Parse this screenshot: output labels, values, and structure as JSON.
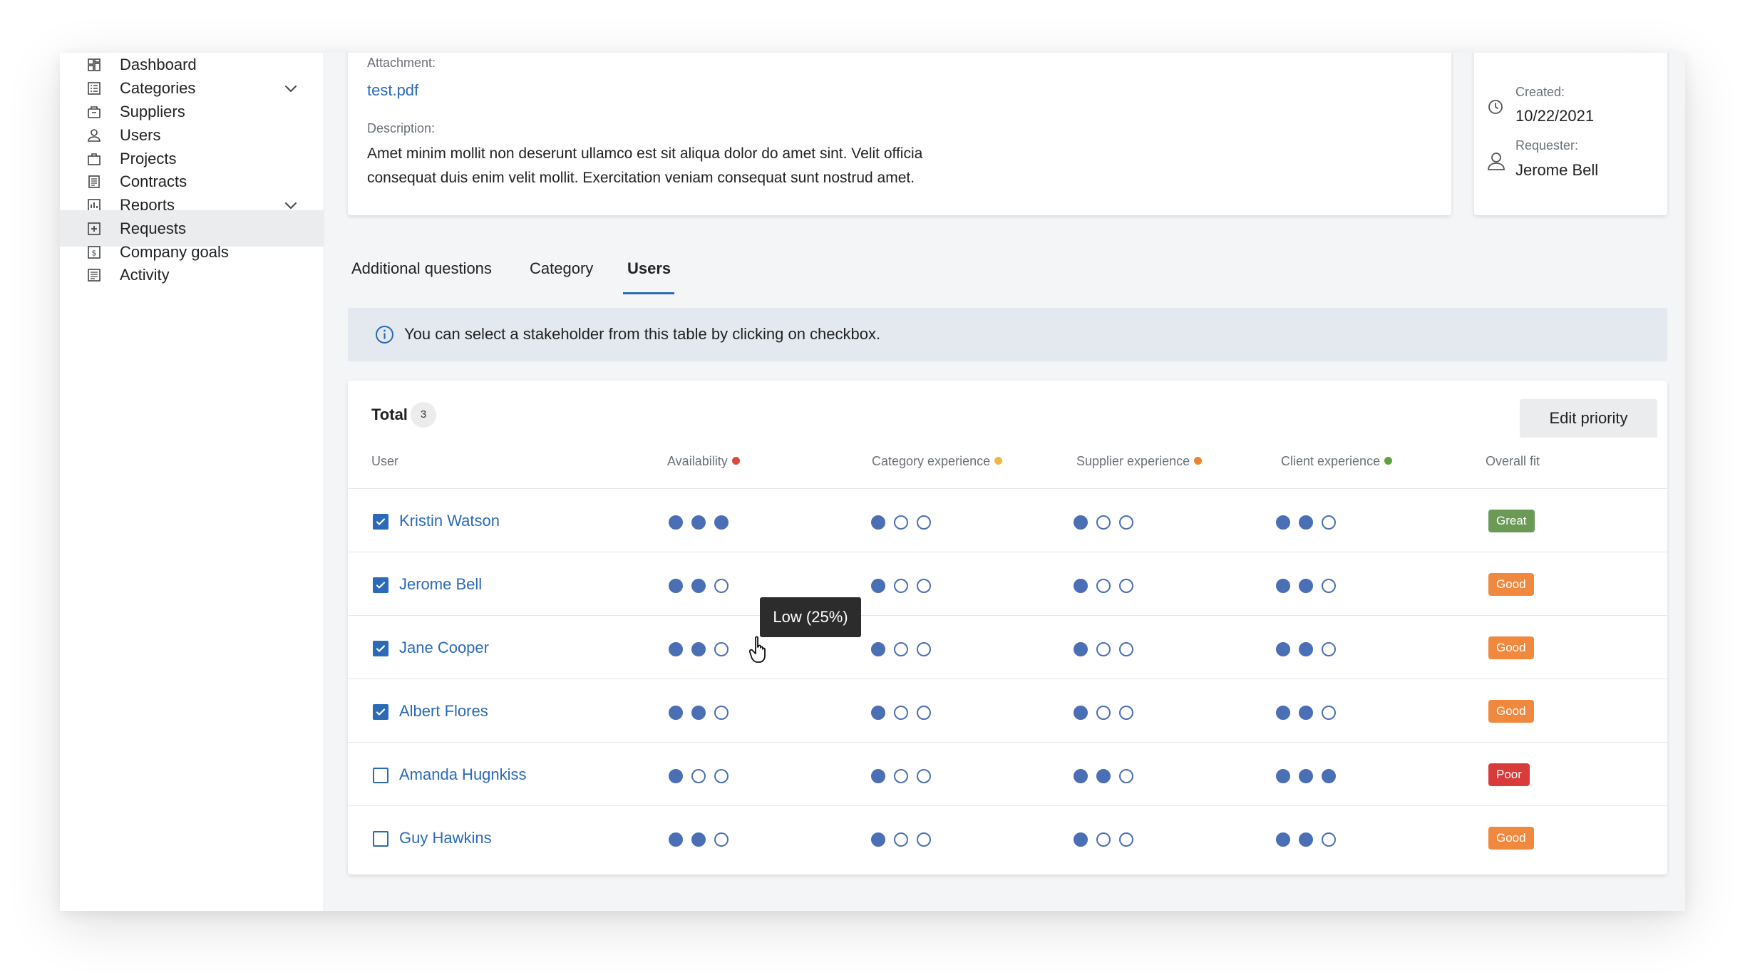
{
  "sidebar": {
    "items": [
      {
        "label": "Dashboard",
        "icon": "dashboard-icon"
      },
      {
        "label": "Categories",
        "icon": "categories-icon",
        "expandable": true
      },
      {
        "label": "Suppliers",
        "icon": "suppliers-icon"
      },
      {
        "label": "Users",
        "icon": "user-icon"
      },
      {
        "label": "Projects",
        "icon": "briefcase-icon"
      },
      {
        "label": "Contracts",
        "icon": "contract-icon"
      },
      {
        "label": "Reports",
        "icon": "reports-icon",
        "expandable": true
      },
      {
        "label": "Requests",
        "icon": "requests-icon",
        "active": true
      },
      {
        "label": "Company goals",
        "icon": "goals-icon"
      },
      {
        "label": "Activity",
        "icon": "activity-icon"
      }
    ]
  },
  "details": {
    "attachment_label": "Attachment:",
    "attachment_file": "test.pdf",
    "description_label": "Description:",
    "description_line1": "Amet minim mollit non deserunt ullamco est sit aliqua dolor do amet sint. Velit officia",
    "description_line2": "consequat duis enim velit mollit. Exercitation veniam consequat sunt nostrud amet."
  },
  "meta": {
    "created_label": "Created:",
    "created_value": "10/22/2021",
    "requester_label": "Requester:",
    "requester_value": "Jerome Bell"
  },
  "tabs": [
    {
      "label": "Additional questions"
    },
    {
      "label": "Category"
    },
    {
      "label": "Users",
      "active": true
    }
  ],
  "info_banner": "You can select a stakeholder from this table by clicking on checkbox.",
  "table": {
    "total_label": "Total",
    "total_count": "3",
    "edit_priority_label": "Edit priority",
    "columns": {
      "user": "User",
      "availability": "Availability",
      "category_experience": "Category experience",
      "supplier_experience": "Supplier experience",
      "client_experience": "Client experience",
      "overall_fit": "Overall fit"
    },
    "priority_colors": {
      "availability": "#e0483e",
      "category_experience": "#f2b544",
      "supplier_experience": "#f0832f",
      "client_experience": "#5aa33d"
    },
    "fit_colors": {
      "Great": "#6b9a57",
      "Good": "#f0883e",
      "Poor": "#d93b3b"
    },
    "rows": [
      {
        "name": "Kristin Watson",
        "checked": true,
        "availability": 3,
        "category": 1,
        "supplier": 1,
        "client": 2,
        "fit": "Great"
      },
      {
        "name": "Jerome Bell",
        "checked": true,
        "availability": 2,
        "category": 1,
        "supplier": 1,
        "client": 2,
        "fit": "Good"
      },
      {
        "name": "Jane Cooper",
        "checked": true,
        "availability": 2,
        "category": 1,
        "supplier": 1,
        "client": 2,
        "fit": "Good"
      },
      {
        "name": "Albert Flores",
        "checked": true,
        "availability": 2,
        "category": 1,
        "supplier": 1,
        "client": 2,
        "fit": "Good"
      },
      {
        "name": "Amanda Hugnkiss",
        "checked": false,
        "availability": 1,
        "category": 1,
        "supplier": 2,
        "client": 3,
        "fit": "Poor"
      },
      {
        "name": "Guy Hawkins",
        "checked": false,
        "availability": 2,
        "category": 1,
        "supplier": 1,
        "client": 2,
        "fit": "Good"
      }
    ]
  },
  "tooltip": "Low (25%)"
}
